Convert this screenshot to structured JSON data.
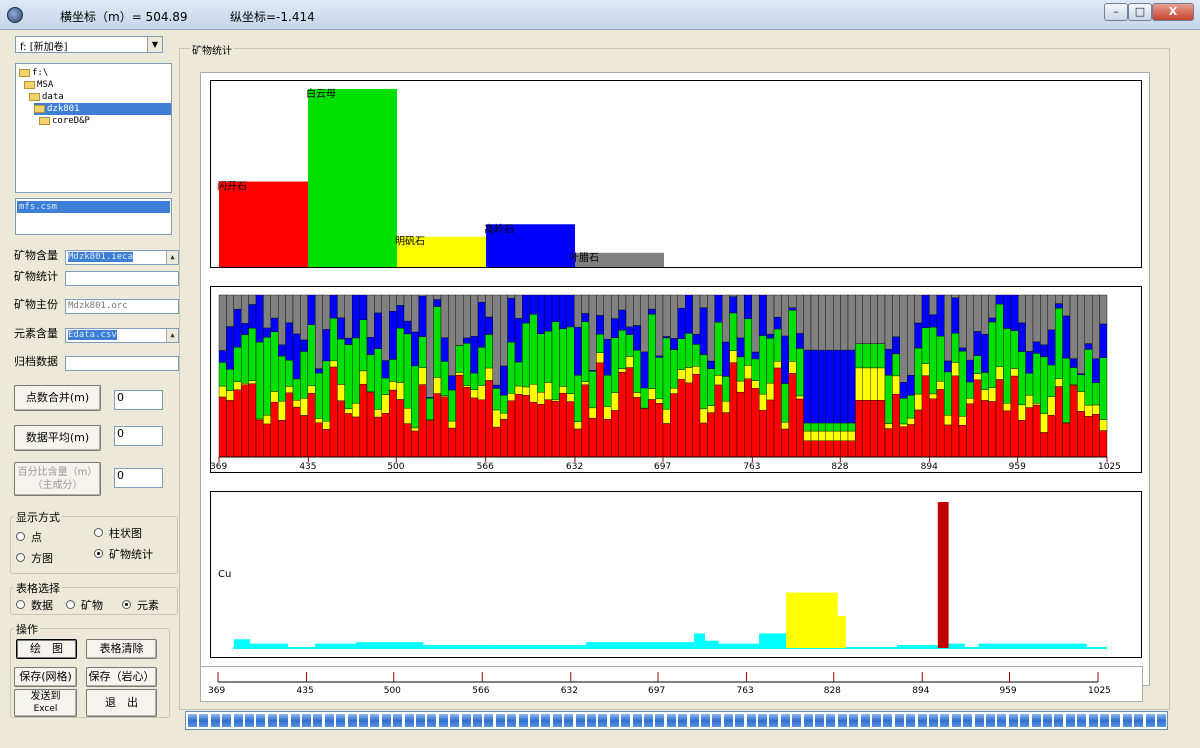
{
  "titlebar": {
    "x_readout": "横坐标（m）= 504.89",
    "y_readout": "纵坐标=-1.414",
    "min": "–",
    "max": "□",
    "close": "X"
  },
  "left": {
    "drive": "f: [新加卷]",
    "tree": [
      "f:\\",
      "MSA",
      "data",
      "dzk801",
      "coreD&P"
    ],
    "selected_dir_index": 3,
    "files": [
      "mfs.csm"
    ],
    "fields": [
      {
        "label": "矿物含量",
        "value": "Mdzk801.ieca",
        "selected": true
      },
      {
        "label": "矿物统计",
        "value": "",
        "selected": false
      },
      {
        "label": "矿物主份",
        "value": "Mdzk801.orc",
        "selected": false
      },
      {
        "label": "元素含量",
        "value": "Edata.csv",
        "selected": true
      },
      {
        "label": "归档数据",
        "value": "",
        "selected": false
      }
    ],
    "merge_button": "点数合并(m)",
    "merge_value": "0",
    "average_button": "数据平均(m)",
    "average_value": "0",
    "percent_button_line1": "百分比含量（m）",
    "percent_button_line2": "（主成分）",
    "percent_value": "0",
    "display_group": "显示方式",
    "display_options": [
      {
        "label": "点",
        "checked": false
      },
      {
        "label": "柱状图",
        "checked": false
      },
      {
        "label": "方图",
        "checked": false
      },
      {
        "label": "矿物统计",
        "checked": true
      }
    ],
    "table_group": "表格选择",
    "table_options": [
      {
        "label": "数据",
        "checked": false
      },
      {
        "label": "矿物",
        "checked": false
      },
      {
        "label": "元素",
        "checked": true
      }
    ],
    "ops_group": "操作",
    "ops": {
      "draw": "绘　图",
      "clear": "表格清除",
      "save_grid": "保存(网格)",
      "save_core": "保存（岩心）",
      "excel1": "发送到",
      "excel2": "Excel",
      "exit": "退　出"
    }
  },
  "main": {
    "group_title": "矿物统计"
  },
  "colors": {
    "red": "#ff0000",
    "green": "#00e000",
    "yellow": "#ffff00",
    "blue": "#0000ff",
    "gray": "#808080",
    "cyan": "#00ffff",
    "darkred": "#c00000"
  },
  "chart_data": [
    {
      "type": "bar",
      "categories": [
        "闪开石",
        "白云母",
        "明矾石",
        "高岭石",
        "叶腊石"
      ],
      "values": [
        48,
        100,
        17,
        24,
        8
      ],
      "colors": [
        "#ff0000",
        "#00e000",
        "#ffff00",
        "#0000ff",
        "#808080"
      ],
      "title": "",
      "xlabel": "",
      "ylabel": ""
    },
    {
      "type": "stacked-bar",
      "ticks": [
        369,
        435,
        500,
        566,
        632,
        697,
        763,
        828,
        894,
        959,
        1025
      ],
      "xlim": [
        369,
        1025
      ],
      "series_colors": [
        "#ff0000",
        "#ffff00",
        "#00e000",
        "#0000ff",
        "#808080"
      ]
    },
    {
      "type": "bar",
      "label": "Cu",
      "ticks": [
        369,
        435,
        500,
        566,
        632,
        697,
        763,
        828,
        894,
        959,
        1025
      ],
      "xlim": [
        369,
        1025
      ],
      "segments": [
        {
          "x0": 380,
          "x1": 392,
          "v": 0.06,
          "c": "#00ffff"
        },
        {
          "x0": 392,
          "x1": 420,
          "v": 0.03,
          "c": "#00ffff"
        },
        {
          "x0": 440,
          "x1": 470,
          "v": 0.03,
          "c": "#00ffff"
        },
        {
          "x0": 470,
          "x1": 520,
          "v": 0.04,
          "c": "#00ffff"
        },
        {
          "x0": 520,
          "x1": 570,
          "v": 0.02,
          "c": "#00ffff"
        },
        {
          "x0": 570,
          "x1": 640,
          "v": 0.02,
          "c": "#00ffff"
        },
        {
          "x0": 640,
          "x1": 720,
          "v": 0.04,
          "c": "#00ffff"
        },
        {
          "x0": 720,
          "x1": 728,
          "v": 0.1,
          "c": "#00ffff"
        },
        {
          "x0": 728,
          "x1": 738,
          "v": 0.05,
          "c": "#00ffff"
        },
        {
          "x0": 738,
          "x1": 768,
          "v": 0.03,
          "c": "#00ffff"
        },
        {
          "x0": 768,
          "x1": 788,
          "v": 0.1,
          "c": "#00ffff"
        },
        {
          "x0": 788,
          "x1": 826,
          "v": 0.38,
          "c": "#ffff00"
        },
        {
          "x0": 826,
          "x1": 832,
          "v": 0.22,
          "c": "#ffff00"
        },
        {
          "x0": 870,
          "x1": 900,
          "v": 0.02,
          "c": "#00ffff"
        },
        {
          "x0": 900,
          "x1": 908,
          "v": 1.0,
          "c": "#c00000"
        },
        {
          "x0": 908,
          "x1": 920,
          "v": 0.03,
          "c": "#00ffff"
        },
        {
          "x0": 930,
          "x1": 1010,
          "v": 0.03,
          "c": "#00ffff"
        }
      ]
    },
    {
      "type": "axis",
      "ticks": [
        369,
        435,
        500,
        566,
        632,
        697,
        763,
        828,
        894,
        959,
        1025
      ]
    }
  ]
}
